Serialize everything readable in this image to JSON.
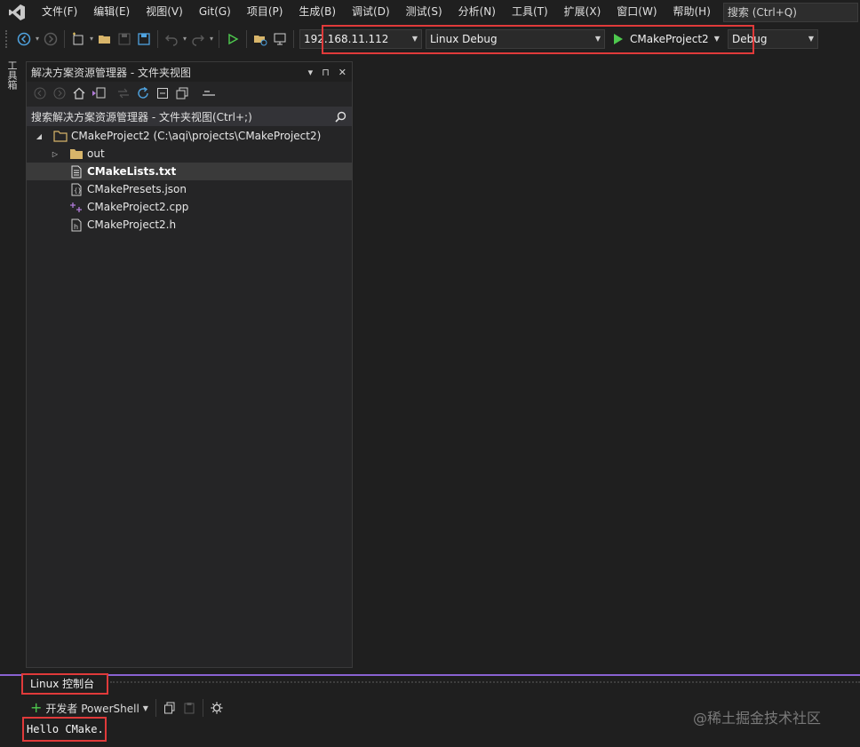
{
  "menu": {
    "items": [
      "文件(F)",
      "编辑(E)",
      "视图(V)",
      "Git(G)",
      "项目(P)",
      "生成(B)",
      "调试(D)",
      "测试(S)",
      "分析(N)",
      "工具(T)",
      "扩展(X)",
      "窗口(W)",
      "帮助(H)"
    ],
    "search_label": "搜索 (Ctrl+Q)"
  },
  "toolbar": {
    "remote_host": "192.168.11.112",
    "configuration": "Linux Debug",
    "startup_item": "CMakeProject2",
    "build_type": "Debug"
  },
  "toolbox": {
    "label": "工具箱"
  },
  "solution_explorer": {
    "title": "解决方案资源管理器 - 文件夹视图",
    "title_actions": [
      "▾",
      "⊓",
      "✕"
    ],
    "search_placeholder": "搜索解决方案资源管理器 - 文件夹视图(Ctrl+;)",
    "root": "CMakeProject2 (C:\\aqi\\projects\\CMakeProject2)",
    "items": [
      {
        "label": "out",
        "type": "folder"
      },
      {
        "label": "CMakeLists.txt",
        "type": "text",
        "selected": true
      },
      {
        "label": "CMakePresets.json",
        "type": "json"
      },
      {
        "label": "CMakeProject2.cpp",
        "type": "cpp"
      },
      {
        "label": "CMakeProject2.h",
        "type": "header"
      }
    ]
  },
  "console": {
    "tab_label": "Linux 控制台",
    "shell_button": "开发者 PowerShell",
    "output": "Hello CMake."
  },
  "watermark": "@稀土掘金技术社区",
  "colors": {
    "highlight_red": "#e03a3a",
    "accent_purple": "#8a63d2",
    "run_green": "#4ec94e",
    "folder_tan": "#d8b56a"
  }
}
